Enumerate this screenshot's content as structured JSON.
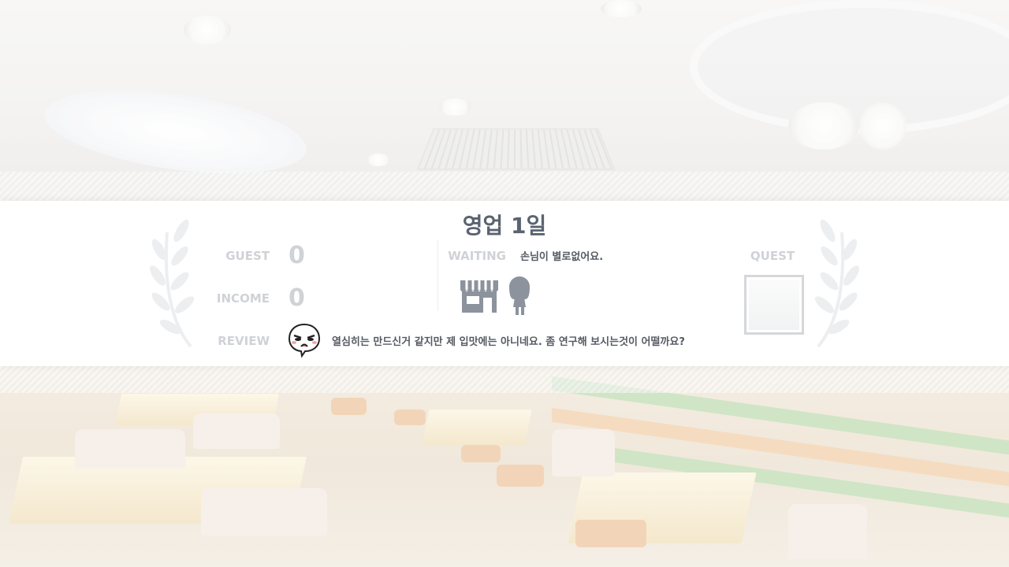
{
  "title": "영업 1일",
  "stats": {
    "guest_label": "GUEST",
    "guest_value": "0",
    "income_label": "INCOME",
    "income_value": "0",
    "review_label": "REVIEW"
  },
  "waiting": {
    "label": "WAITING",
    "message": "손님이 별로없어요."
  },
  "review": {
    "comment": "열심히는 만드신거 같지만 제 입맛에는 아니네요. 좀 연구해 보시는것이 어떨까요?",
    "reviewer_icon": "unhappy-customer-face-icon"
  },
  "quest": {
    "label": "QUEST"
  },
  "icons": {
    "shop": "shop-icon",
    "customer": "customer-silhouette-icon",
    "laurel_left": "laurel-left-icon",
    "laurel_right": "laurel-right-icon"
  },
  "colors": {
    "title": "#5a6470",
    "label_muted": "#cfd2d6",
    "text": "#555b63",
    "icon_gray": "#8c939c"
  }
}
